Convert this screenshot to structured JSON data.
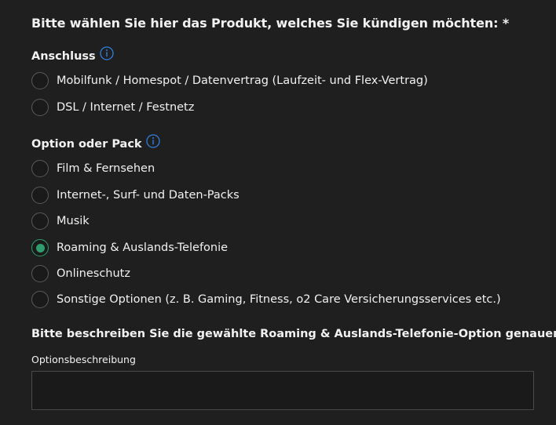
{
  "form": {
    "question": "Bitte wählen Sie hier das Produkt, welches Sie kündigen möchten: *",
    "groups": [
      {
        "title": "Anschluss",
        "info_icon": "info-icon",
        "options": [
          {
            "label": "Mobilfunk / Homespot / Datenvertrag (Laufzeit- und Flex-Vertrag)",
            "selected": false
          },
          {
            "label": "DSL / Internet / Festnetz",
            "selected": false
          }
        ]
      },
      {
        "title": "Option oder Pack",
        "info_icon": "info-icon",
        "options": [
          {
            "label": "Film & Fernsehen",
            "selected": false
          },
          {
            "label": "Internet-, Surf- und Daten-Packs",
            "selected": false
          },
          {
            "label": "Musik",
            "selected": false
          },
          {
            "label": "Roaming & Auslands-Telefonie",
            "selected": true
          },
          {
            "label": "Onlineschutz",
            "selected": false
          },
          {
            "label": "Sonstige Optionen (z. B. Gaming, Fitness, o2 Care Versicherungsservices etc.)",
            "selected": false
          }
        ]
      }
    ],
    "details_heading": "Bitte beschreiben Sie die gewählte Roaming & Auslands-Telefonie-Option genauer",
    "description_field": {
      "label": "Optionsbeschreibung",
      "value": ""
    }
  },
  "colors": {
    "background": "#1f1f1f",
    "text": "#f2f2f2",
    "accent_selected": "#2f9e6e",
    "info_icon": "#2f7fe0"
  }
}
